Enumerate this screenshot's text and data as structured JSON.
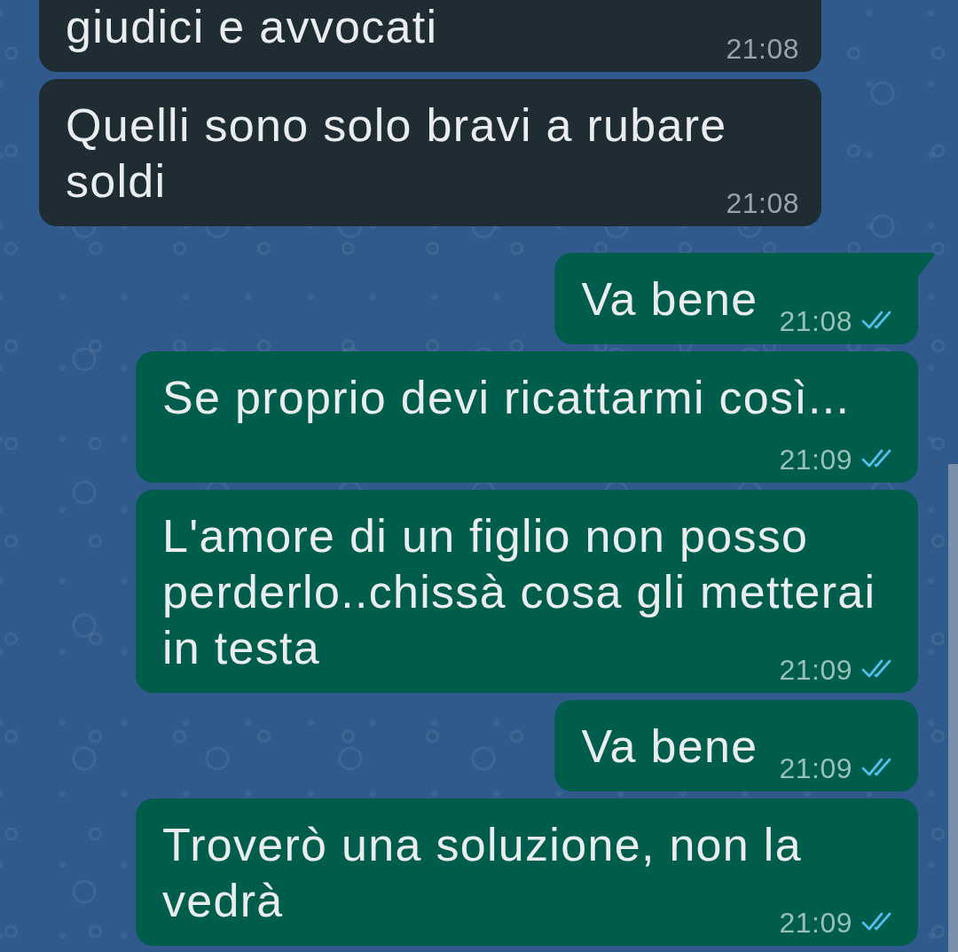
{
  "messages": [
    {
      "kind": "incoming",
      "lines": [
        "giudici e avvocati"
      ],
      "time": "21:08",
      "truncated": true,
      "tail": false
    },
    {
      "kind": "incoming",
      "lines": [
        "Quelli sono solo bravi a rubare",
        "soldi"
      ],
      "time": "21:08",
      "truncated": false,
      "tail": false
    },
    {
      "kind": "outgoing",
      "lines": [
        "Va bene"
      ],
      "time": "21:08",
      "read": true,
      "truncated": false,
      "tail": true
    },
    {
      "kind": "outgoing",
      "lines": [
        "Se proprio devi ricattarmi così..."
      ],
      "time": "21:09",
      "read": true,
      "truncated": false,
      "tail": false
    },
    {
      "kind": "outgoing",
      "lines": [
        "L'amore di un figlio non posso",
        "perderlo..chissà cosa gli metterai",
        "in testa"
      ],
      "time": "21:09",
      "read": true,
      "truncated": false,
      "tail": false
    },
    {
      "kind": "outgoing",
      "lines": [
        "Va bene"
      ],
      "time": "21:09",
      "read": true,
      "truncated": false,
      "tail": false
    },
    {
      "kind": "outgoing",
      "lines": [
        "Troverò una soluzione, non la",
        "vedrà"
      ],
      "time": "21:09",
      "read": true,
      "truncated": false,
      "tail": false
    }
  ]
}
